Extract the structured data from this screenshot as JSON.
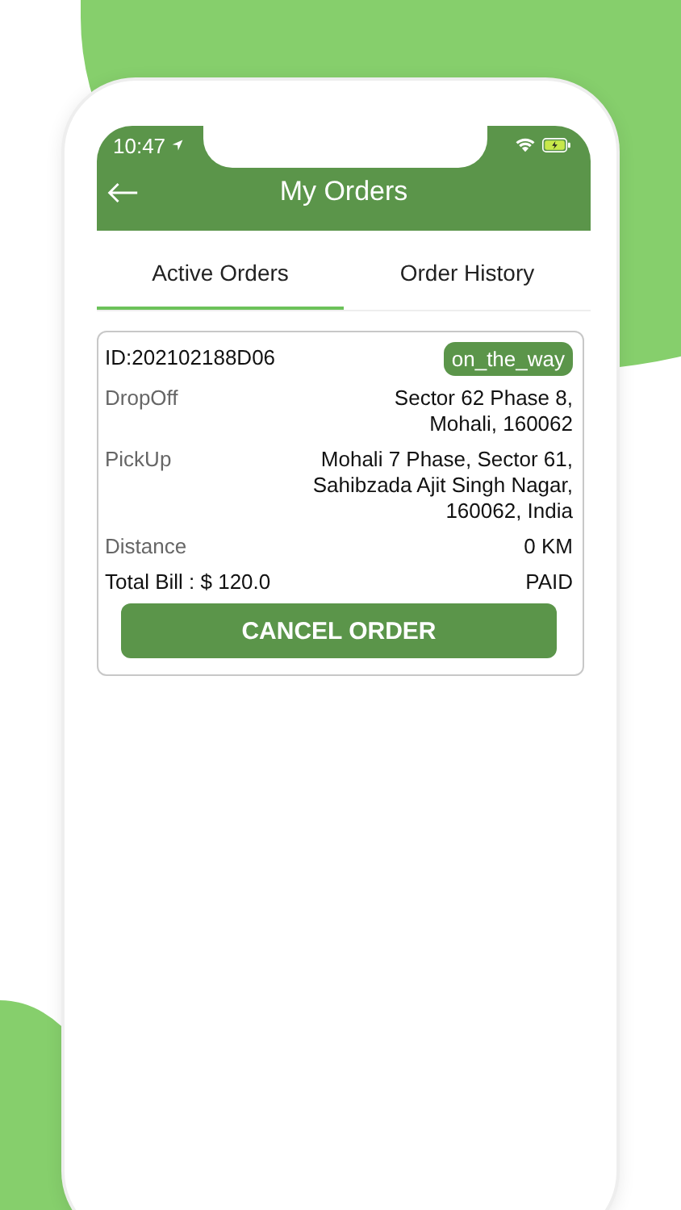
{
  "status_bar": {
    "time": "10:47"
  },
  "header": {
    "title": "My Orders"
  },
  "tabs": [
    {
      "label": "Active Orders",
      "selected": true
    },
    {
      "label": "Order History",
      "selected": false
    }
  ],
  "order": {
    "id": "ID:202102188D06",
    "status": "on_the_way",
    "rows": [
      {
        "label": "DropOff",
        "value_lines": [
          "Sector 62 Phase 8,",
          "Mohali, 160062"
        ]
      },
      {
        "label": "PickUp",
        "value_lines": [
          "Mohali 7 Phase, Sector 61,",
          "Sahibzada Ajit Singh Nagar,",
          "160062, India"
        ]
      },
      {
        "label": "Distance",
        "value_lines": [
          "0 KM"
        ]
      }
    ],
    "total": "Total Bill : $ 120.0",
    "payment": "PAID",
    "button": "CANCEL ORDER"
  }
}
